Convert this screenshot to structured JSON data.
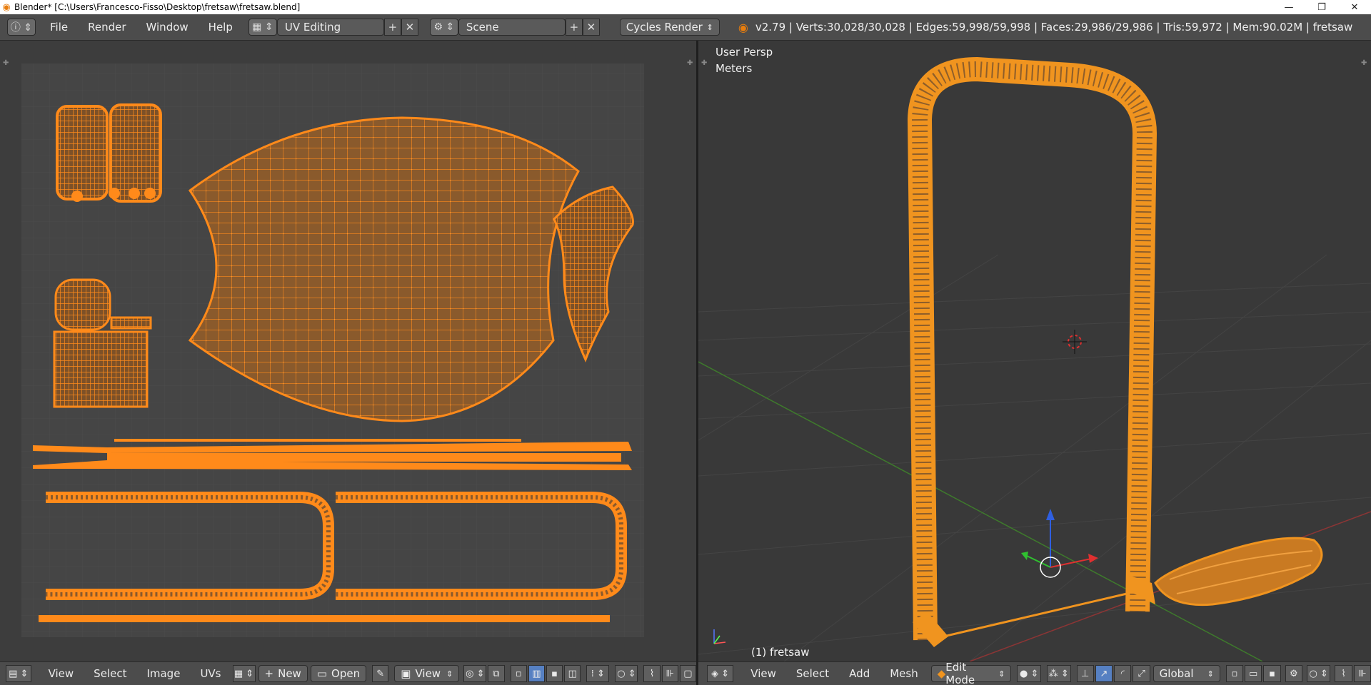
{
  "window": {
    "title": "Blender* [C:\\Users\\Francesco-Fisso\\Desktop\\fretsaw\\fretsaw.blend]",
    "minimize": "—",
    "maximize": "❐",
    "close": "✕"
  },
  "info_header": {
    "menus": [
      "File",
      "Render",
      "Window",
      "Help"
    ],
    "screen_layout": "UV Editing",
    "scene": "Scene",
    "render_engine": "Cycles Render",
    "stats": "v2.79 | Verts:30,028/30,028 | Edges:59,998/59,998 | Faces:29,986/29,986 | Tris:59,972 | Mem:90.02M | fretsaw"
  },
  "uv_editor": {
    "footer": {
      "menus": [
        "View",
        "Select",
        "Image",
        "UVs"
      ],
      "new_label": "New",
      "open_label": "Open",
      "view_label": "View"
    }
  },
  "view3d": {
    "view_name": "User Persp",
    "units": "Meters",
    "object_info": "(1) fretsaw",
    "footer": {
      "menus": [
        "View",
        "Select",
        "Add",
        "Mesh"
      ],
      "mode": "Edit Mode",
      "orientation": "Global"
    }
  },
  "colors": {
    "uv_selected": "#ff8a1a",
    "mesh_selected": "#f0941f",
    "background": "#3d3d3d",
    "header": "#4c4c4c"
  }
}
